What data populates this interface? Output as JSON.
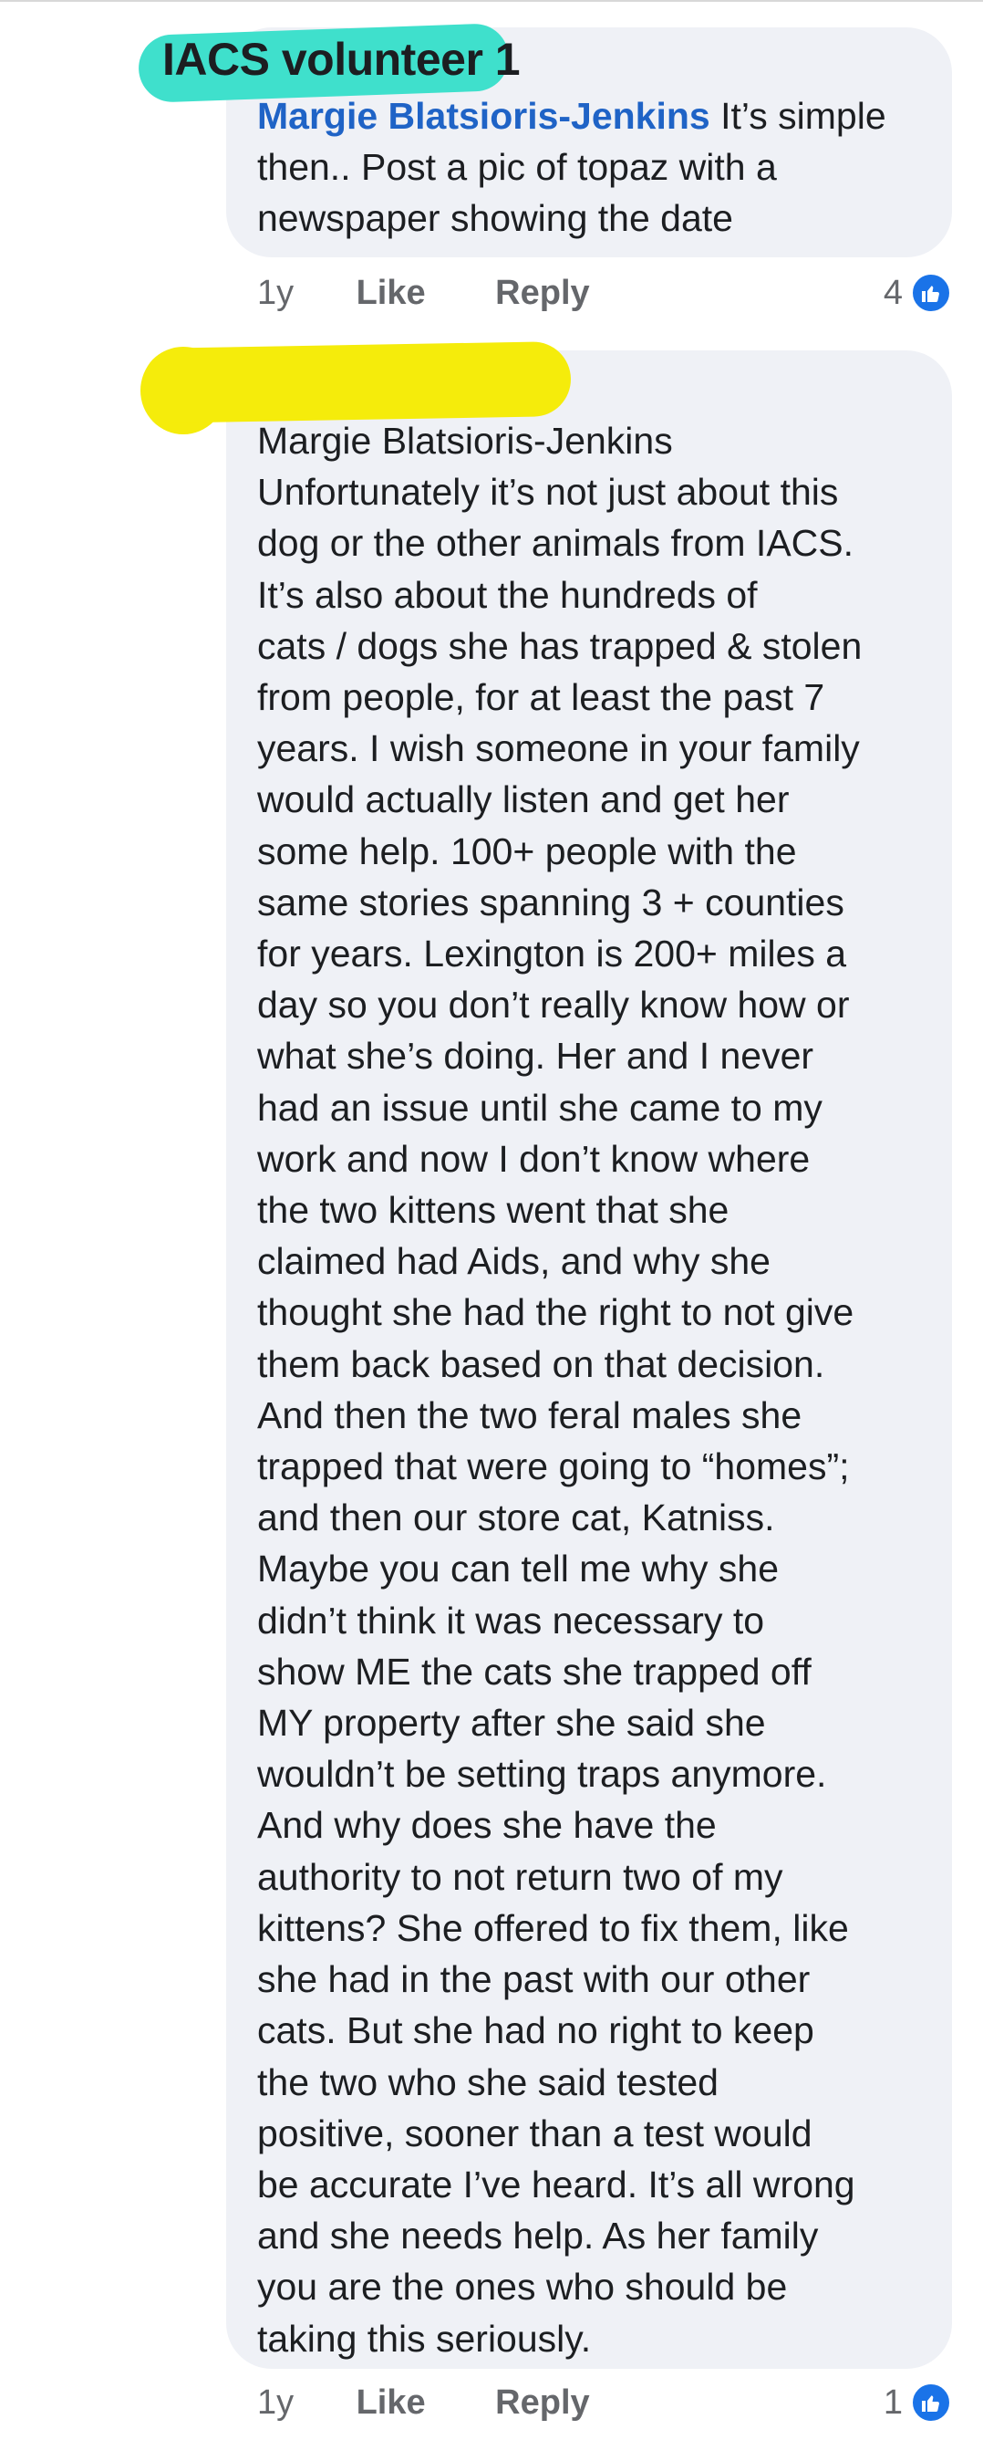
{
  "comments": [
    {
      "author": "IACS volunteer 1",
      "tag": "Margie Blatsioris-Jenkins",
      "lines": [
        " It’s simple",
        "then.. Post a pic of topaz with a",
        "newspaper showing the date"
      ],
      "time": "1y",
      "like_label": "Like",
      "reply_label": "Reply",
      "reaction_count": "4",
      "reaction_icon": "thumbs-up-icon"
    },
    {
      "author_redacted": true,
      "lines": [
        "Margie Blatsioris-Jenkins",
        "Unfortunately it’s not just about this",
        "dog or the other animals from IACS.",
        "It’s also about the hundreds of",
        "cats / dogs she has trapped & stolen",
        "from people, for at least the past 7",
        "years. I wish someone in your family",
        "would actually listen and get her",
        "some help. 100+ people with the",
        "same stories spanning 3 + counties",
        "for years. Lexington is 200+ miles a",
        "day so you don’t really know how or",
        "what she’s doing.  Her and I never",
        "had an issue until she came to my",
        "work and now I don’t know where",
        "the two kittens went that she",
        "claimed had Aids, and why she",
        "thought she had the right to not give",
        "them back based on that decision.",
        "And then the two feral males she",
        "trapped that were going to “homes”;",
        "and then our store cat, Katniss.",
        "Maybe you can tell me why she",
        "didn’t think it was necessary to",
        "show ME the cats she trapped off",
        "MY property after she said she",
        "wouldn’t be setting traps anymore.",
        "And why does she have the",
        "authority to not return two of my",
        "kittens? She offered to fix them, like",
        "she had in the past with our other",
        "cats. But she had no right to keep",
        "the two who she said tested",
        "positive, sooner than a test would",
        "be accurate I’ve heard. It’s all wrong",
        "and she needs help. As her family",
        "you are the ones who should be",
        "taking this seriously."
      ],
      "time": "1y",
      "like_label": "Like",
      "reply_label": "Reply",
      "reaction_count": "1",
      "reaction_icon": "thumbs-up-icon"
    }
  ],
  "colors": {
    "bubble": "#eff1f6",
    "tag_link": "#1f63c6",
    "meta_text": "#65676b",
    "highlight_cyan": "#3fe0cc",
    "redaction_yellow": "#f5ec0b",
    "like_badge": "#1a73e8"
  }
}
